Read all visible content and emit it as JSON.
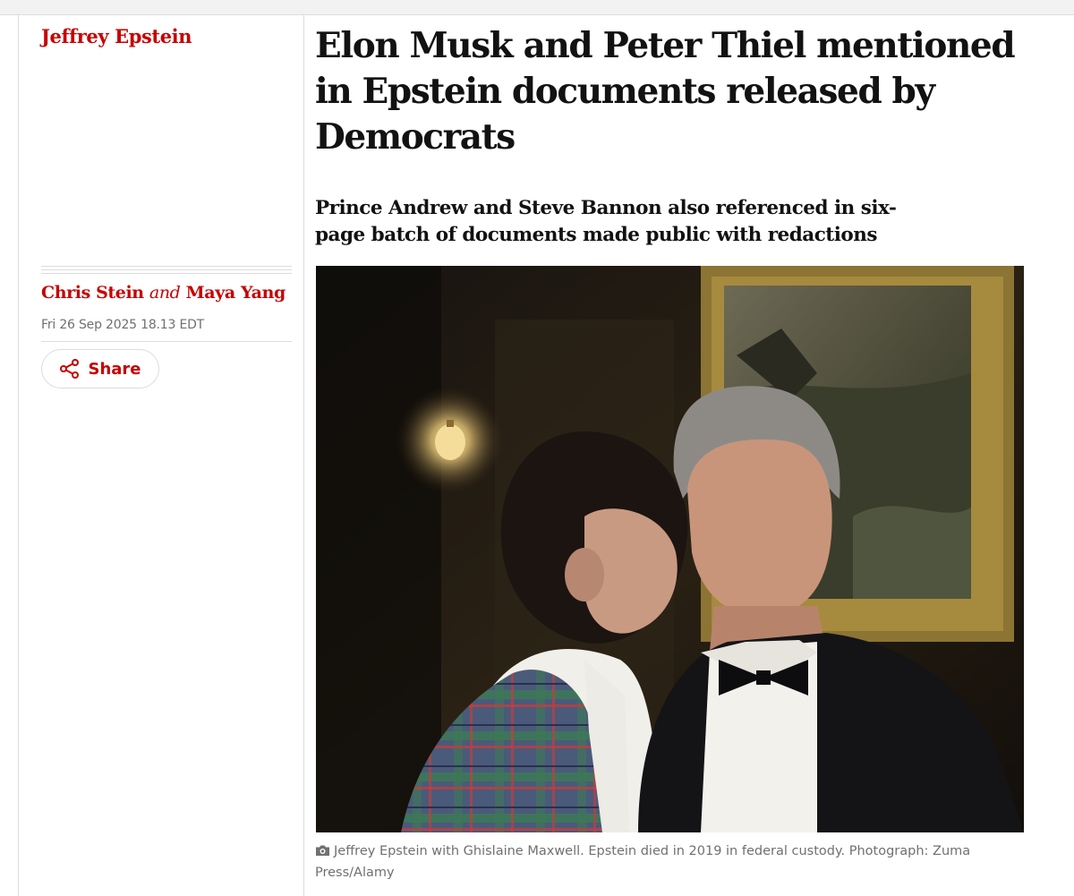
{
  "series": {
    "label": "Jeffrey Epstein"
  },
  "article": {
    "headline": "Elon Musk and Peter Thiel mentioned in Epstein documents released by Democrats",
    "standfirst": "Prince Andrew and Steve Bannon also referenced in six-page batch of documents made public with redactions",
    "byline": {
      "author1": "Chris Stein",
      "joiner": "and",
      "author2": "Maya Yang"
    },
    "dateline": "Fri 26 Sep 2025 18.13 EDT",
    "share_label": "Share",
    "image": {
      "caption": "Jeffrey Epstein with Ghislaine Maxwell. Epstein died in 2019 in federal custody.",
      "credit": "Photograph: Zuma Press/Alamy"
    }
  },
  "icons": {
    "share": "share-icon",
    "camera": "camera-icon"
  },
  "colors": {
    "accent": "#c70000",
    "text": "#121212",
    "muted": "#707070",
    "divider": "#dcdcdc"
  }
}
